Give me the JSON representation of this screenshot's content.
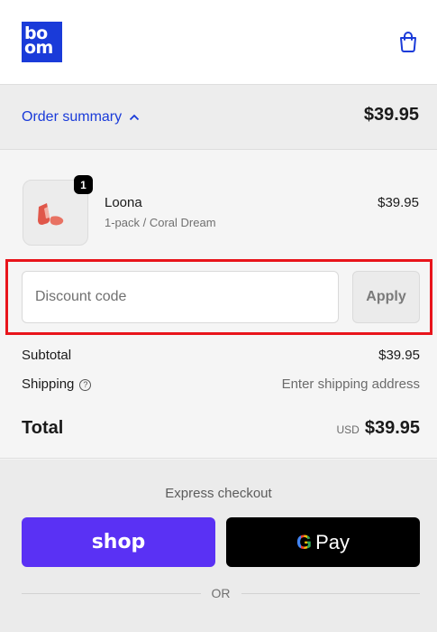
{
  "header": {
    "logo_line1": "bo",
    "logo_line2": "om",
    "bag_icon": "shopping-bag-icon"
  },
  "summary_bar": {
    "toggle_label": "Order summary",
    "chevron_icon": "chevron-up-icon",
    "total": "$39.95"
  },
  "product": {
    "quantity": "1",
    "name": "Loona",
    "variant": "1-pack / Coral Dream",
    "price": "$39.95"
  },
  "discount": {
    "placeholder": "Discount code",
    "apply_label": "Apply"
  },
  "totals": {
    "subtotal_label": "Subtotal",
    "subtotal_value": "$39.95",
    "shipping_label": "Shipping",
    "shipping_value": "Enter shipping address",
    "total_label": "Total",
    "currency": "USD",
    "total_value": "$39.95"
  },
  "express": {
    "title": "Express checkout",
    "shop_label": "shop",
    "gpay_g": "G",
    "gpay_label": "Pay",
    "or_label": "OR"
  },
  "colors": {
    "accent": "#1a3bd9",
    "shop_purple": "#5a31f4",
    "highlight_red": "#e8141b"
  }
}
